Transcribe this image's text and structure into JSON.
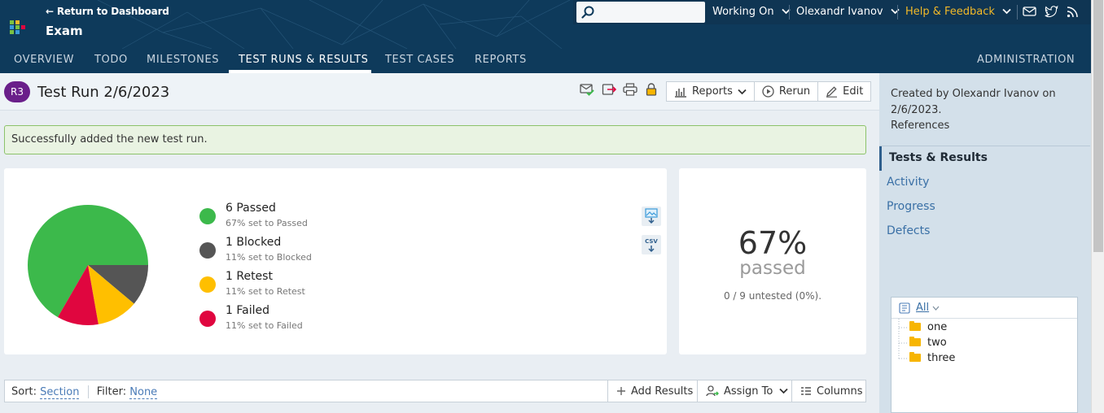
{
  "header": {
    "back_link": "← Return to Dashboard",
    "project_title": "Exam",
    "search_placeholder": "",
    "working_on": "Working On",
    "user": "Olexandr Ivanov",
    "help": "Help & Feedback",
    "icons": [
      "mail-icon",
      "twitter-icon",
      "rss-icon"
    ],
    "colors": {
      "header_bg": "#0e3a5b",
      "help": "#f2b928"
    }
  },
  "nav": {
    "items": [
      "OVERVIEW",
      "TODO",
      "MILESTONES",
      "TEST RUNS & RESULTS",
      "TEST CASES",
      "REPORTS"
    ],
    "admin": "ADMINISTRATION",
    "active": "TEST RUNS & RESULTS"
  },
  "run": {
    "badge": "R3",
    "title": "Test Run 2/6/2023",
    "buttons": {
      "reports": "Reports",
      "rerun": "Rerun",
      "edit": "Edit"
    }
  },
  "alert": {
    "message": "Successfully added the new test run."
  },
  "summary": {
    "legend": [
      {
        "label": "6 Passed",
        "sub": "67% set to Passed",
        "color": "#3cb94b"
      },
      {
        "label": "1 Blocked",
        "sub": "11% set to Blocked",
        "color": "#555555"
      },
      {
        "label": "1 Retest",
        "sub": "11% set to Retest",
        "color": "#ffbf00"
      },
      {
        "label": "1 Failed",
        "sub": "11% set to Failed",
        "color": "#e0063f"
      }
    ],
    "percent": "67%",
    "percent_label": "passed",
    "untested": "0 / 9 untested (0%)."
  },
  "chart_data": {
    "type": "pie",
    "categories": [
      "Passed",
      "Blocked",
      "Retest",
      "Failed"
    ],
    "values": [
      6,
      1,
      1,
      1
    ],
    "colors": [
      "#3cb94b",
      "#555555",
      "#ffbf00",
      "#e0063f"
    ]
  },
  "toolbar": {
    "sort_label": "Sort:",
    "sort_value": "Section",
    "filter_label": "Filter:",
    "filter_value": "None",
    "add_results": "Add Results",
    "assign_to": "Assign To",
    "columns": "Columns"
  },
  "sidebar": {
    "created_by": "Created by Olexandr Ivanov on 2/6/2023.",
    "references": "References",
    "tabs": [
      "Tests & Results",
      "Activity",
      "Progress",
      "Defects"
    ],
    "tree": {
      "filter": "All",
      "items": [
        "one",
        "two",
        "three"
      ]
    }
  }
}
